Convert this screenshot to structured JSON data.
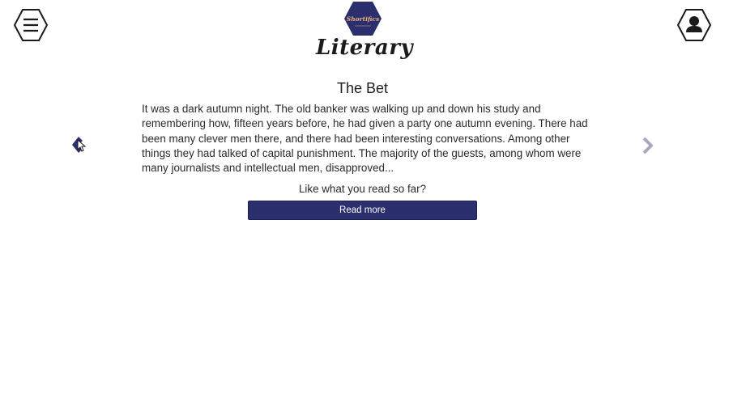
{
  "header": {
    "logo_text": "Shortifics",
    "category_title": "Literary",
    "menu_icon": "hamburger-menu-icon",
    "account_icon": "user-account-icon",
    "brand_color": "#2b2f6e",
    "logo_accent": "#f0b07a"
  },
  "story": {
    "title": "The Bet",
    "excerpt": "It was a dark autumn night. The old banker was walking up and down his study and remembering how, fifteen years before, he had given a party one autumn evening. There had been many clever men there, and there had been interesting conversations. Among other things they had talked of capital punishment. The majority of the guests, among whom were many journalists and intellectual men, disapproved...",
    "prompt": "Like what you read so far?",
    "read_more_label": "Read more"
  },
  "carousel": {
    "prev_icon": "chevron-left-icon",
    "next_icon": "chevron-right-icon"
  }
}
